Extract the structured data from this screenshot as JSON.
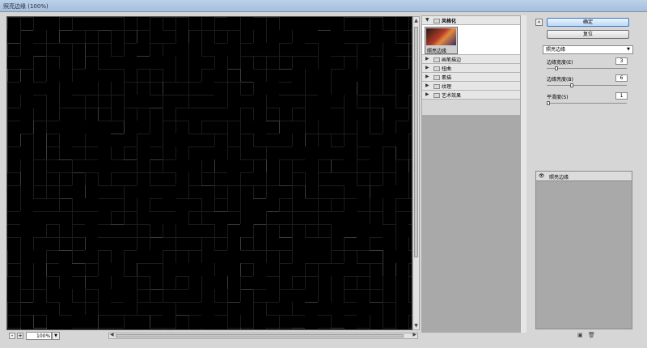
{
  "window": {
    "title": "照亮边缘 (100%)"
  },
  "preview": {
    "zoom": "100%",
    "zoom_out": "-",
    "zoom_in": "+"
  },
  "gallery": {
    "open_category": "风格化",
    "thumbnail_label": "照亮边缘",
    "categories": [
      "画笔描边",
      "扭曲",
      "素描",
      "纹理",
      "艺术效果"
    ]
  },
  "buttons": {
    "ok": "确定",
    "reset": "复位"
  },
  "filter_select": "照亮边缘",
  "params": [
    {
      "label": "边缘宽度(E)",
      "value": "3",
      "fraction": 0.1
    },
    {
      "label": "边缘亮度(B)",
      "value": "6",
      "fraction": 0.3
    },
    {
      "label": "平滑度(S)",
      "value": "1",
      "fraction": 0.0
    }
  ],
  "layers": {
    "items": [
      "照亮边缘"
    ]
  },
  "colors": {
    "preview_bg": "#000000",
    "grid_line": "#1c1c1c",
    "panel_bg": "#d6d6d6",
    "gallery_fill": "#a9a9a9"
  },
  "icons": [
    "eye-icon",
    "folder-icon",
    "triangle-icon",
    "new-layer-icon",
    "delete-layer-icon",
    "collapse-icon"
  ]
}
